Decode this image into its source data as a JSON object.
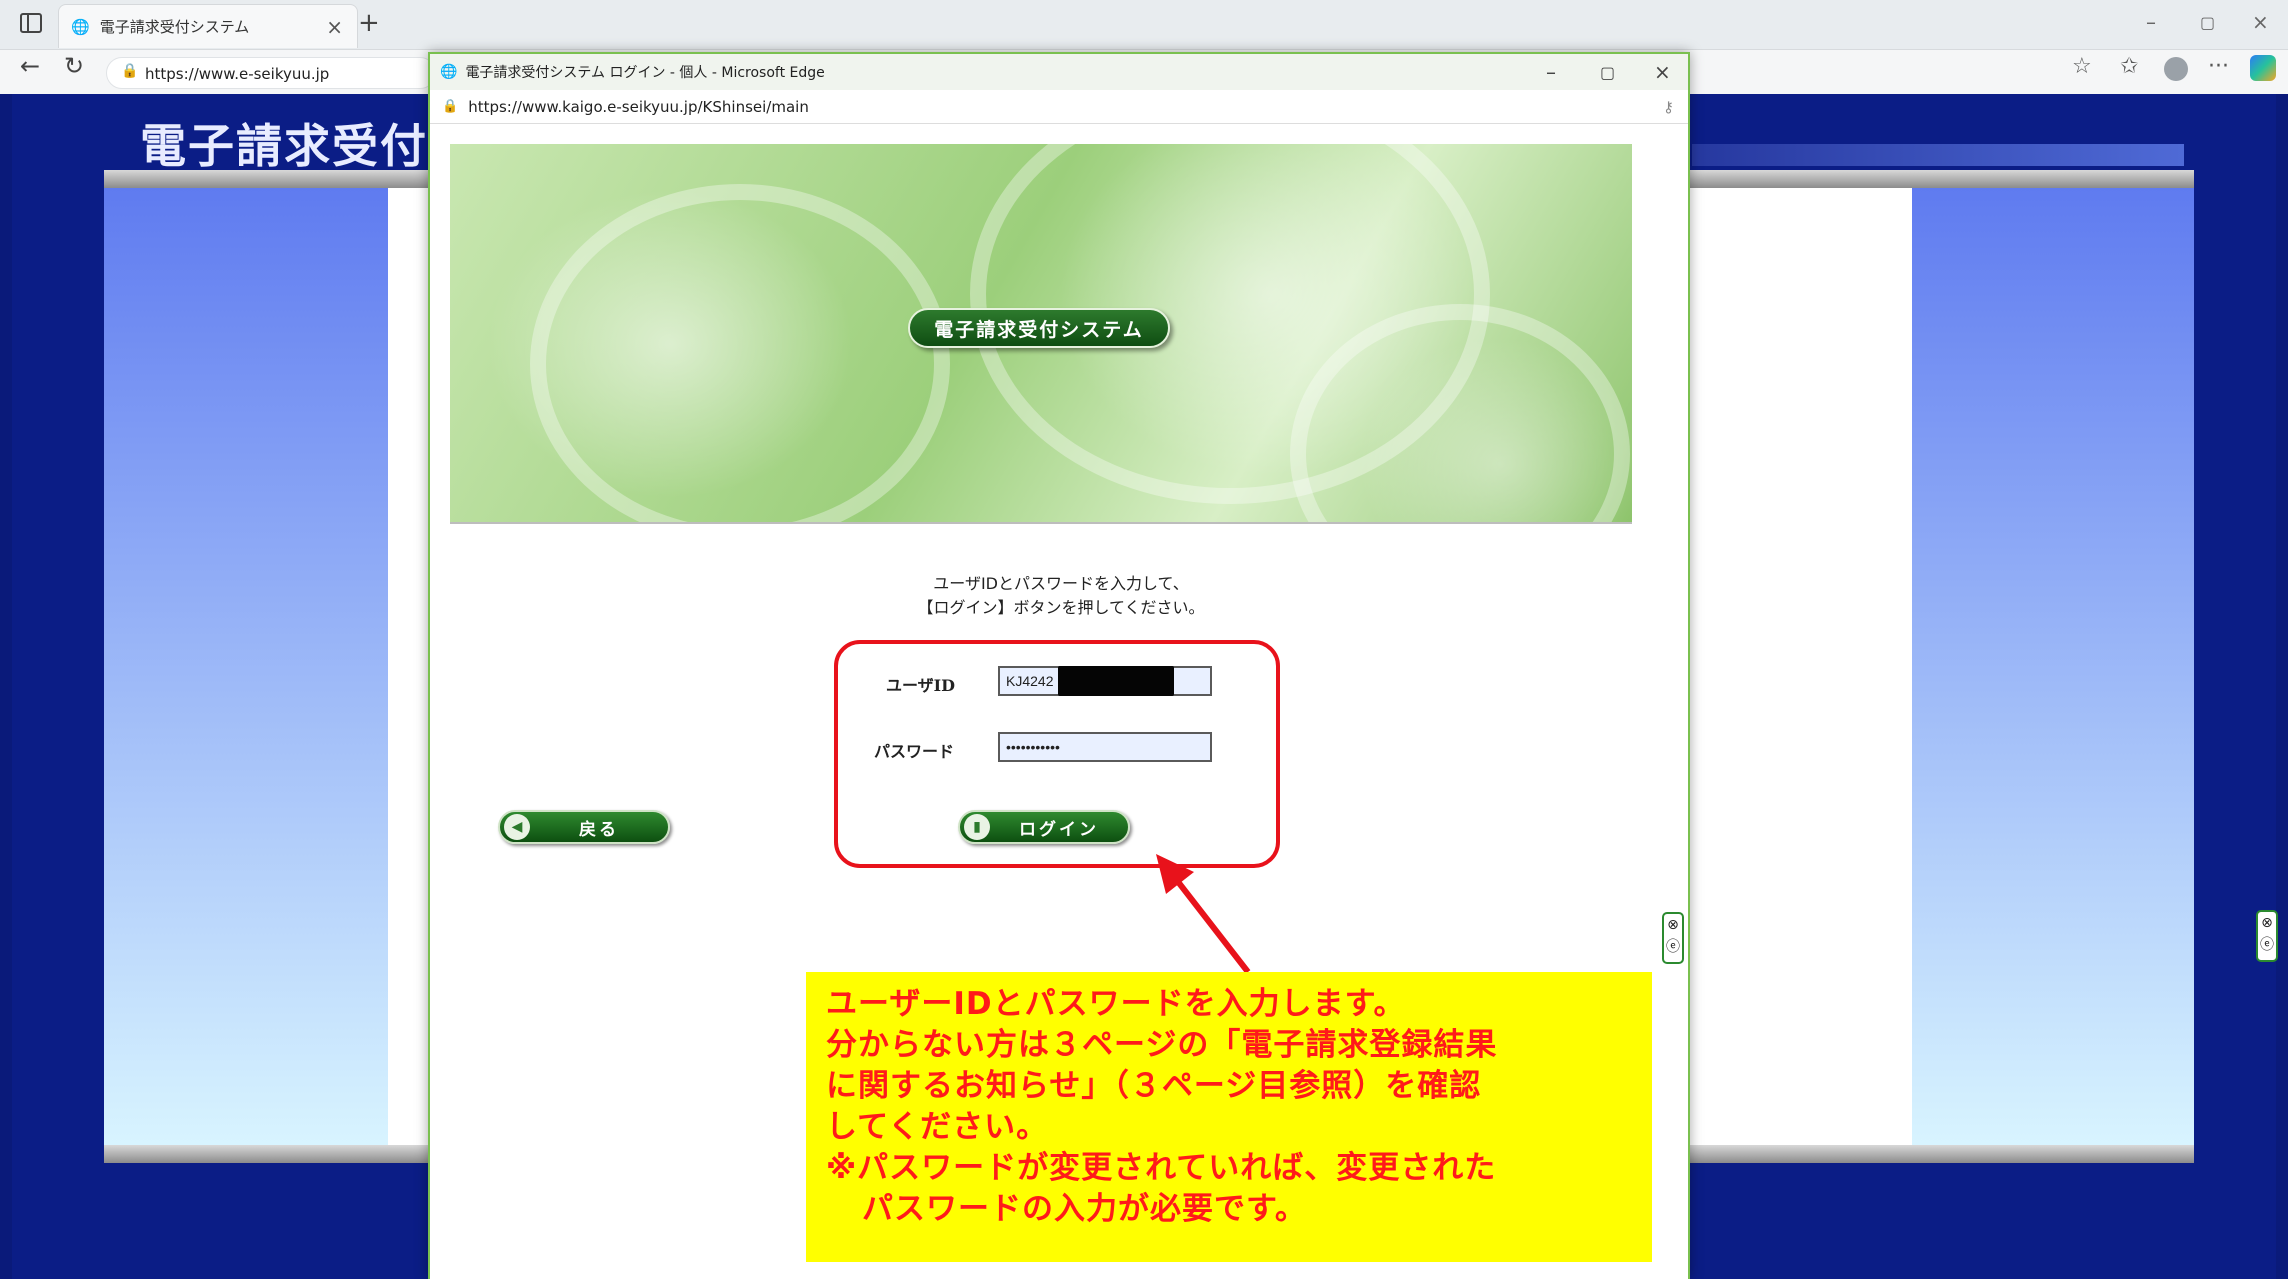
{
  "browser": {
    "tab_title": "電子請求受付システム",
    "tab_close": "×",
    "new_tab": "+",
    "url": "https://www.e-seikyuu.jp",
    "win_min": "–",
    "win_max": "▢",
    "win_close": "×"
  },
  "background_page": {
    "title": "電子請求受付シ"
  },
  "popup": {
    "window_title": "電子請求受付システム ログイン - 個人 - Microsoft Edge",
    "url": "https://www.kaigo.e-seikyuu.jp/KShinsei/main",
    "ctl_min": "–",
    "ctl_max": "▢",
    "ctl_close": "×",
    "hero_badge": "電子請求受付システム",
    "instruction_line1": "ユーザIDとパスワードを入力して、",
    "instruction_line2": "【ログイン】ボタンを押してください。",
    "form": {
      "userid_label": "ユーザID",
      "userid_value": "KJ4242",
      "password_label": "パスワード",
      "password_value": "•••••••••••"
    },
    "back_button": "戻る",
    "login_button": "ログイン"
  },
  "side_badges": {
    "close": "⊗",
    "edge": "ⓔ"
  },
  "annotation": {
    "lines": [
      "ユーザーIDとパスワードを入力します。",
      "分からない方は３ページの「電子請求登録結果",
      "に関するお知らせ」（３ページ目参照）を確認",
      "してください。",
      "※パスワードが変更されていれば、変更された",
      "パスワードの入力が必要です。"
    ]
  },
  "colors": {
    "annotation_bg": "#ffff00",
    "annotation_text": "#ff1a1a",
    "highlight_border": "#e8121b",
    "button_green": "#1f6e22"
  }
}
